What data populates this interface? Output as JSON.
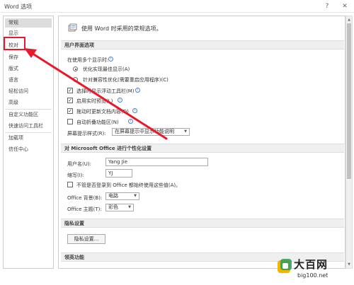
{
  "window": {
    "title": "Word 选项",
    "help_label": "?",
    "close_label": "✕"
  },
  "sidebar": {
    "items": [
      {
        "label": "常规"
      },
      {
        "label": "显示"
      },
      {
        "label": "校对"
      },
      {
        "label": "保存"
      },
      {
        "label": "版式"
      },
      {
        "label": "语言"
      },
      {
        "label": "轻松访问"
      },
      {
        "label": "高级"
      },
      {
        "label": "自定义功能区"
      },
      {
        "label": "快速访问工具栏"
      },
      {
        "label": "加载项"
      },
      {
        "label": "信任中心"
      }
    ]
  },
  "main": {
    "header_text": "使用 Word 时采用的常规选项。",
    "ui_section": {
      "title": "用户界面选项",
      "multi_display_label": "在使用多个显示时:",
      "radio_optimize": "优化实现最佳显示(A)",
      "radio_compat": "针对兼容性优化(需要重启应用程序)(C)",
      "chk_mini_toolbar": "选择时显示浮动工具栏(M)",
      "chk_live_preview": "启用实时预览(L)",
      "chk_update_drag": "拖动时更新文档内容(D)",
      "chk_collapse_ribbon": "自动折叠功能区(N)",
      "screentip_label": "屏幕提示样式(R):",
      "screentip_value": "在屏幕提示中显示功能说明"
    },
    "personal_section": {
      "title": "对 Microsoft Office 进行个性化设置",
      "username_label": "用户名(U):",
      "username_value": "Yang Jie",
      "initials_label": "缩写(I):",
      "initials_value": "YJ",
      "always_use_label": "不管是否登录到 Office 都始终使用这些值(A)。",
      "background_label": "Office 背景(B):",
      "background_value": "电路",
      "theme_label": "Office 主题(T):",
      "theme_value": "彩色"
    },
    "privacy_section": {
      "title": "隐私设置",
      "button_label": "隐私设置..."
    },
    "lead_section": {
      "title": "领英功能"
    }
  },
  "watermark": {
    "main": "大百网",
    "sub": "big100.net"
  },
  "colors": {
    "highlight": "#e8192c",
    "accent": "#4a86c6"
  }
}
